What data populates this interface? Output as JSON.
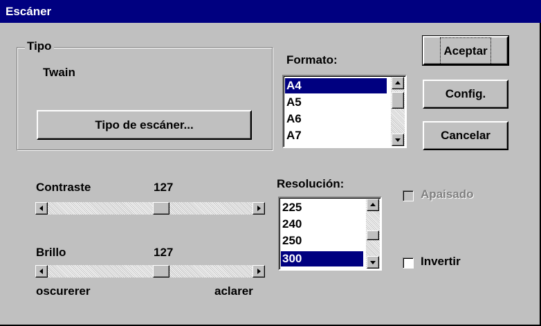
{
  "window": {
    "title": "Escáner"
  },
  "tipo": {
    "legend": "Tipo",
    "value": "Twain",
    "button_label": "Tipo de escáner..."
  },
  "buttons": {
    "accept": "Aceptar",
    "config": "Config.",
    "cancel": "Cancelar"
  },
  "formato": {
    "label": "Formato:",
    "options": [
      "A4",
      "A5",
      "A6",
      "A7"
    ],
    "selected": "A4"
  },
  "resolucion": {
    "label": "Resolución:",
    "options": [
      "225",
      "240",
      "250",
      "300"
    ],
    "selected": "300"
  },
  "contraste": {
    "label": "Contraste",
    "value": "127"
  },
  "brillo": {
    "label": "Brillo",
    "value": "127",
    "min_label": "oscurerer",
    "max_label": "aclarer"
  },
  "apaisado": {
    "label": "Apaisado",
    "checked": false,
    "enabled": false
  },
  "invertir": {
    "label": "Invertir",
    "checked": false,
    "enabled": true
  }
}
